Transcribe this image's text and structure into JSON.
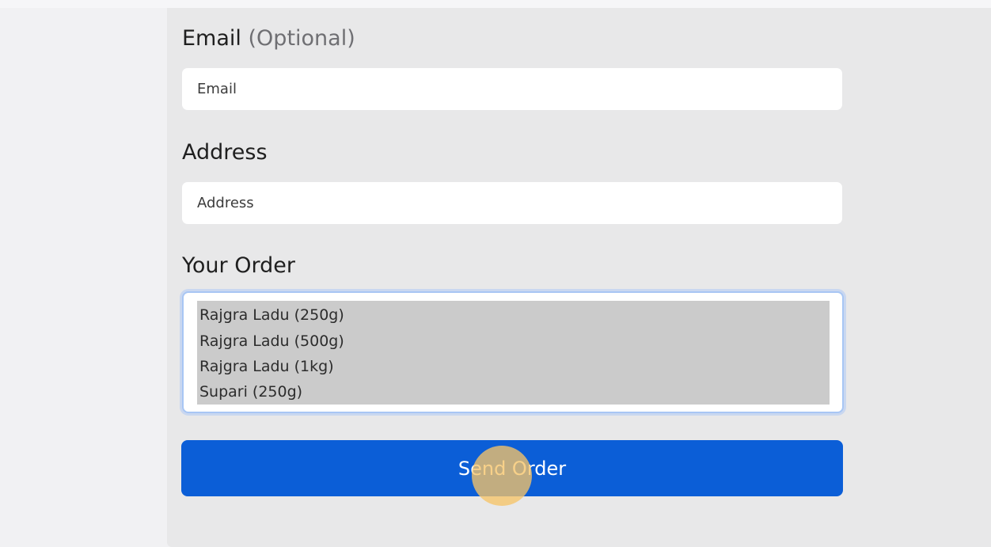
{
  "form": {
    "email": {
      "label": "Email",
      "label_note": "(Optional)",
      "placeholder": "Email"
    },
    "address": {
      "label": "Address",
      "placeholder": "Address"
    },
    "order": {
      "label": "Your Order",
      "options": [
        "Rajgra Ladu (250g)",
        "Rajgra Ladu (500g)",
        "Rajgra Ladu (1kg)",
        "Supari (250g)"
      ]
    },
    "submit_label": "Send Order"
  },
  "colors": {
    "panel": "#e8e8e9",
    "page": "#f1f1f3",
    "accent": "#0b5ed7",
    "selection": "#cbcbcb",
    "focus_ring": "#a8c6f4",
    "cursor_highlight": "#f6c468"
  }
}
